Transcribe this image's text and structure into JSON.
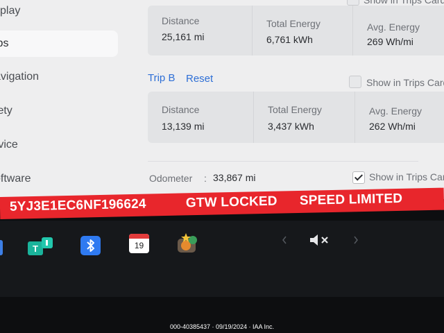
{
  "sidebar": {
    "items": [
      {
        "label": "splay"
      },
      {
        "label": "ips"
      },
      {
        "label": "avigation"
      },
      {
        "label": "fety"
      },
      {
        "label": "rvice"
      },
      {
        "label": "oftware"
      }
    ]
  },
  "trip_a": {
    "cols": [
      {
        "label": "Distance",
        "value": "25,161 mi"
      },
      {
        "label": "Total Energy",
        "value": "6,761 kWh"
      },
      {
        "label": "Avg. Energy",
        "value": "269 Wh/mi"
      }
    ],
    "show_label": "Show in Trips Card"
  },
  "trip_b": {
    "title": "Trip B",
    "reset_label": "Reset",
    "show_label": "Show in Trips Card",
    "cols": [
      {
        "label": "Distance",
        "value": "13,139 mi"
      },
      {
        "label": "Total Energy",
        "value": "3,437 kWh"
      },
      {
        "label": "Avg. Energy",
        "value": "262 Wh/mi"
      }
    ]
  },
  "odometer": {
    "label": "Odometer",
    "separator": ":",
    "value": "33,867 mi",
    "show_label": "Show in Trips Card",
    "checked": true
  },
  "banner": {
    "vin": "5YJ3E1EC6NF196624",
    "gtw": "GTW LOCKED",
    "speed": "SPEED LIMITED",
    "color": "#e8262c"
  },
  "dock": {
    "calendar_day": "19",
    "icons": [
      "toybox-icon",
      "bluetooth-icon",
      "calendar-icon",
      "light-show-icon",
      "chevron-left-icon",
      "mute-icon",
      "chevron-right-icon"
    ]
  },
  "footer": {
    "text": "000-40385437 · 09/19/2024 · IAA Inc."
  }
}
